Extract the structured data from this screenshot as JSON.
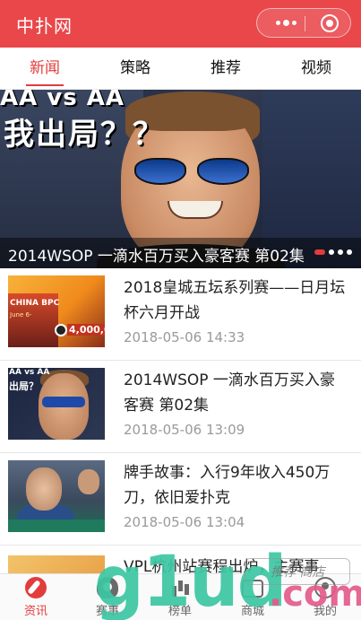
{
  "header": {
    "title": "中扑网",
    "background": "#e9474a"
  },
  "tabs": [
    {
      "label": "新闻",
      "active": true
    },
    {
      "label": "策略",
      "active": false
    },
    {
      "label": "推荐",
      "active": false
    },
    {
      "label": "视频",
      "active": false
    }
  ],
  "banner": {
    "overlay_line1": "AA vs AA",
    "overlay_line2": "我出局？？",
    "caption": "2014WSOP 一滴水百万买入豪客赛 第02集",
    "page_index": 1,
    "page_count": 4
  },
  "news": [
    {
      "title": "2018皇城五坛系列赛——日月坛杯六月开战",
      "time": "2018-05-06 14:33",
      "thumb_text": [
        "CHINA BPC",
        "June 6-",
        "4,000,0"
      ]
    },
    {
      "title": "2014WSOP 一滴水百万买入豪客赛 第02集",
      "time": "2018-05-06 13:09",
      "thumb_text": [
        "AA vs AA",
        "出局？"
      ]
    },
    {
      "title": "牌手故事：入行9年收入450万刀，依旧爱扑克",
      "time": "2018-05-06 13:04"
    },
    {
      "title": "VPL杭州站赛程出炉，主赛事"
    }
  ],
  "tabbar": [
    {
      "label": "资讯",
      "icon": "compass-icon",
      "active": true
    },
    {
      "label": "赛事",
      "icon": "trophy-icon",
      "active": false
    },
    {
      "label": "榜单",
      "icon": "ranking-icon",
      "active": false
    },
    {
      "label": "商城",
      "icon": "shop-icon",
      "active": false
    },
    {
      "label": "我的",
      "icon": "user-icon",
      "active": false
    }
  ],
  "watermark": {
    "text_green": "g1ud",
    "text_pink": ".com",
    "stamp": "推荐 商店"
  },
  "colors": {
    "accent": "#e23c3c",
    "muted": "#9a9a9a"
  }
}
